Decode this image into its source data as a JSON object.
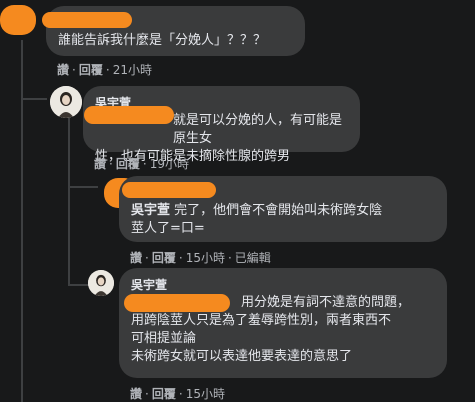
{
  "comments": [
    {
      "text": "誰能告訴我什麼是「分娩人」？？？",
      "actions": {
        "like": "讚",
        "reply": "回覆",
        "time": "21小時"
      }
    },
    {
      "author": "吳宇萱",
      "text_line1": "就是可以分娩的人，有可能是原生女",
      "text_line2": "性，也有可能是未摘除性腺的跨男",
      "actions": {
        "like": "讚",
        "reply": "回覆",
        "time": "19小時"
      }
    },
    {
      "author": "吳宇萱",
      "text_line1": "完了，他們會不會開始叫未術跨女陰",
      "text_line2": "莖人了=口=",
      "actions": {
        "like": "讚",
        "reply": "回覆",
        "time": "15小時",
        "edited": "已編輯"
      }
    },
    {
      "author": "吳宇萱",
      "text_line1": "用分娩是有詞不達意的問題，",
      "text_line2": "用跨陰莖人只是為了羞辱跨性別，兩者東西不",
      "text_line3": "可相提並論",
      "text_line4": "未術跨女就可以表達他要表達的意思了",
      "actions": {
        "like": "讚",
        "reply": "回覆",
        "time": "15小時"
      }
    }
  ],
  "colors": {
    "background": "#18191a",
    "bubble": "#3a3b3c",
    "redaction": "#f58a1f",
    "secondary_text": "#b0b3b8"
  }
}
